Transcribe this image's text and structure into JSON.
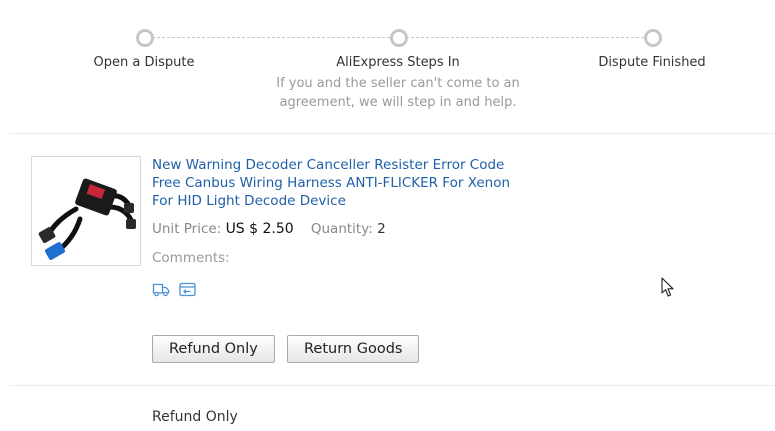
{
  "steps": [
    {
      "title": "Open a Dispute",
      "desc": ""
    },
    {
      "title": "AliExpress Steps In",
      "desc": "If you and the seller can't come to an agreement, we will step in and help."
    },
    {
      "title": "Dispute Finished",
      "desc": ""
    }
  ],
  "product": {
    "title": "New Warning Decoder Canceller Resister Error Code Free Canbus Wiring Harness ANTI-FLICKER For Xenon For HID Light Decode Device",
    "unit_price_label": "Unit Price:",
    "unit_price_value": "US $ 2.50",
    "quantity_label": "Quantity:",
    "quantity_value": "2",
    "comments_label": "Comments:",
    "icons": [
      "shipping-truck-icon",
      "return-card-icon"
    ]
  },
  "actions": {
    "refund_only_label": "Refund Only",
    "return_goods_label": "Return Goods"
  },
  "section": {
    "title": "Refund Only"
  },
  "colors": {
    "link": "#2060a8",
    "icon": "#4a8fd8",
    "step_dot": "#c6c6c6"
  }
}
